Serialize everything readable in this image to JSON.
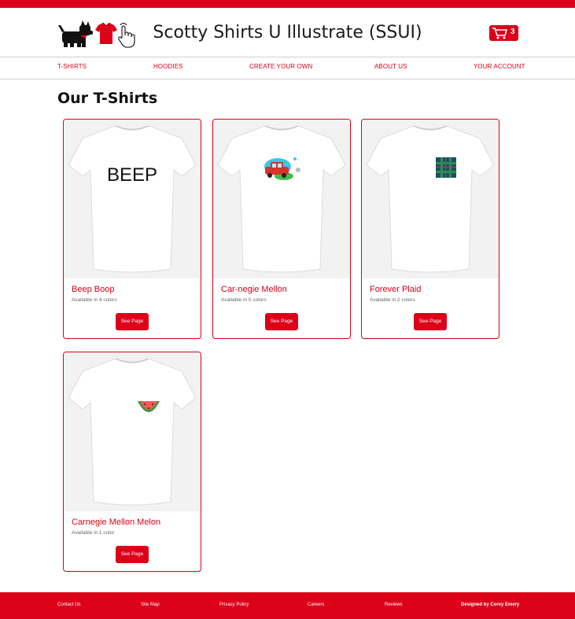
{
  "header": {
    "title": "Scotty Shirts U Illustrate (SSUI)",
    "cart_count": "3"
  },
  "nav": {
    "items": [
      "T-SHIRTS",
      "HOODIES",
      "CREATE YOUR OWN",
      "ABOUT US",
      "YOUR ACCOUNT"
    ]
  },
  "main": {
    "heading": "Our T-Shirts",
    "products": [
      {
        "name": "Beep Boop",
        "colors": "Available in 4 colors",
        "button": "See Page",
        "print": "BEEP"
      },
      {
        "name": "Car-negie Mellon",
        "colors": "Available in 5 colors",
        "button": "See Page"
      },
      {
        "name": "Forever Plaid",
        "colors": "Available in 2 colors",
        "button": "See Page"
      },
      {
        "name": "Carnegie Mellon Melon",
        "colors": "Available in 1 color",
        "button": "See Page"
      }
    ]
  },
  "footer": {
    "links": [
      "Contact Us",
      "Site Map",
      "Privacy Policy",
      "Careers",
      "Reviews"
    ],
    "credit": "Designed by Corey Emery"
  },
  "colors": {
    "brand_red": "#dc0019",
    "card_bg": "#f2f2f2"
  },
  "icons": [
    "scottie-dog-icon",
    "shirt-icon",
    "pointer-hand-icon",
    "shopping-cart-icon"
  ]
}
